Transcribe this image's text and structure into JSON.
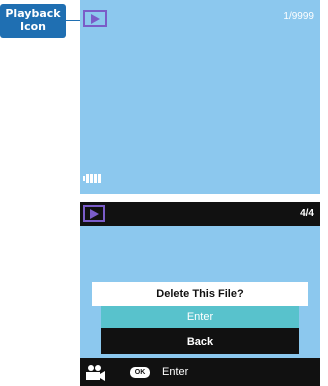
{
  "callout": {
    "line1": "Playback",
    "line2": "Icon"
  },
  "top_screen": {
    "counter": "1/9999",
    "icons": [
      "play-icon",
      "battery-icon"
    ],
    "colors": {
      "background": "#8cc8ee",
      "accent": "#7a5cc8"
    }
  },
  "bottom_screen": {
    "counter": "4/4",
    "dialog": {
      "title": "Delete This File?",
      "options": {
        "enter": "Enter",
        "back": "Back"
      }
    },
    "footer": {
      "ok_label": "OK",
      "enter_label": "Enter"
    },
    "icons": [
      "play-icon",
      "movie-camera-icon",
      "ok-button-icon"
    ],
    "colors": {
      "background": "#8cc8ee",
      "selection": "#58c2cc",
      "bar": "#111111"
    }
  }
}
